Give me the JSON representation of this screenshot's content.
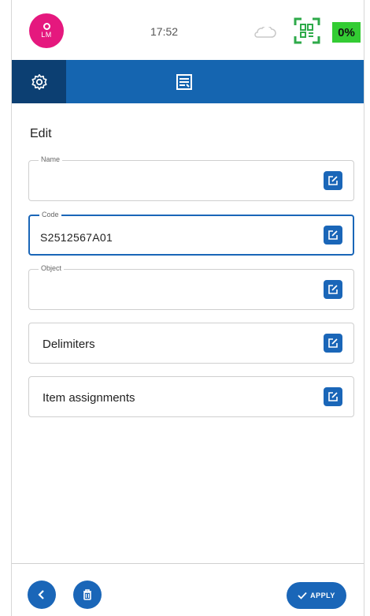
{
  "status": {
    "avatar_initials": "LM",
    "time": "17:52",
    "battery": "0%"
  },
  "icons": {
    "settings": "gear-icon",
    "form_tab": "form-icon",
    "edit": "edit-icon",
    "back": "chevron-left-icon",
    "delete": "trash-icon",
    "apply": "check-icon",
    "scanner": "barcode-scanner-icon",
    "cloud": "cloud-icon"
  },
  "colors": {
    "primary": "#1565b0",
    "nav_active": "#0c3f72",
    "avatar": "#e5187e",
    "battery": "#33cc33"
  },
  "edit": {
    "title": "Edit",
    "fields": [
      {
        "label": "Name",
        "value": ""
      },
      {
        "label": "Code",
        "value": "S2512567A01"
      },
      {
        "label": "Object",
        "value": ""
      }
    ],
    "sections": [
      {
        "label": "Delimiters"
      },
      {
        "label": "Item assignments"
      }
    ]
  },
  "footer": {
    "apply_label": "APPLY"
  }
}
